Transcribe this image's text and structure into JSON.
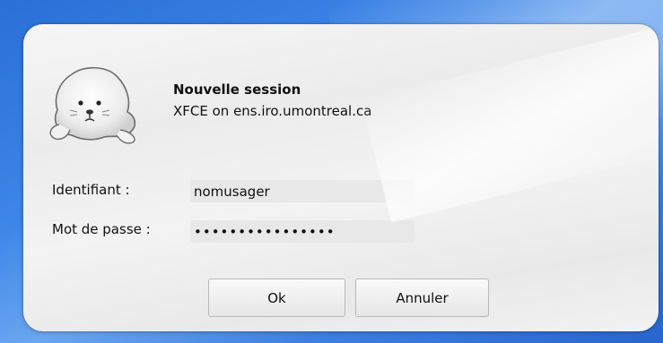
{
  "session": {
    "title": "Nouvelle session",
    "host": "XFCE on ens.iro.umontreal.ca"
  },
  "form": {
    "username_label": "Identifiant :",
    "username_value": "nomusager",
    "password_label": "Mot de passe :",
    "password_value": "••••••••••••••••"
  },
  "buttons": {
    "ok_label": "Ok",
    "cancel_label": "Annuler"
  },
  "icons": {
    "logo": "seal-icon"
  }
}
